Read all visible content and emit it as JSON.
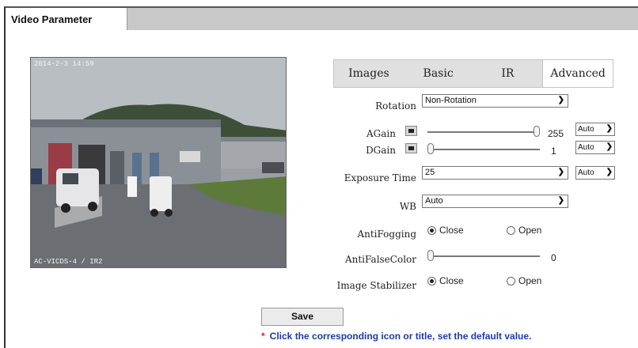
{
  "header": {
    "title": "Video Parameter"
  },
  "video": {
    "osd_top": "2014-2-3 14:59",
    "osd_bottom": "AC-VICDS-4 / IR2"
  },
  "tabs": [
    "Images",
    "Basic",
    "IR",
    "Advanced"
  ],
  "active_tab": "Advanced",
  "settings": {
    "rotation": {
      "label": "Rotation",
      "value": "Non-Rotation"
    },
    "again": {
      "label": "AGain",
      "value": "255",
      "mode": "Auto",
      "level": 1.0
    },
    "dgain": {
      "label": "DGain",
      "value": "1",
      "mode": "Auto",
      "level": 0.0
    },
    "exposure": {
      "label": "Exposure Time",
      "value": "25",
      "mode": "Auto"
    },
    "wb": {
      "label": "WB",
      "value": "Auto"
    },
    "antifogging": {
      "label": "AntiFogging",
      "options": [
        "Close",
        "Open"
      ],
      "selected": "Close"
    },
    "antifalsecolor": {
      "label": "AntiFalseColor",
      "value": "0",
      "level": 0.0
    },
    "stabilizer": {
      "label": "Image Stabilizer",
      "options": [
        "Close",
        "Open"
      ],
      "selected": "Close"
    }
  },
  "save_label": "Save",
  "note": {
    "star": "*",
    "text": "Click the corresponding icon or title, set the default value."
  },
  "colors": {
    "note": "#1f3aa8",
    "star": "#e02020",
    "header_bar": "#c8c8c8"
  }
}
